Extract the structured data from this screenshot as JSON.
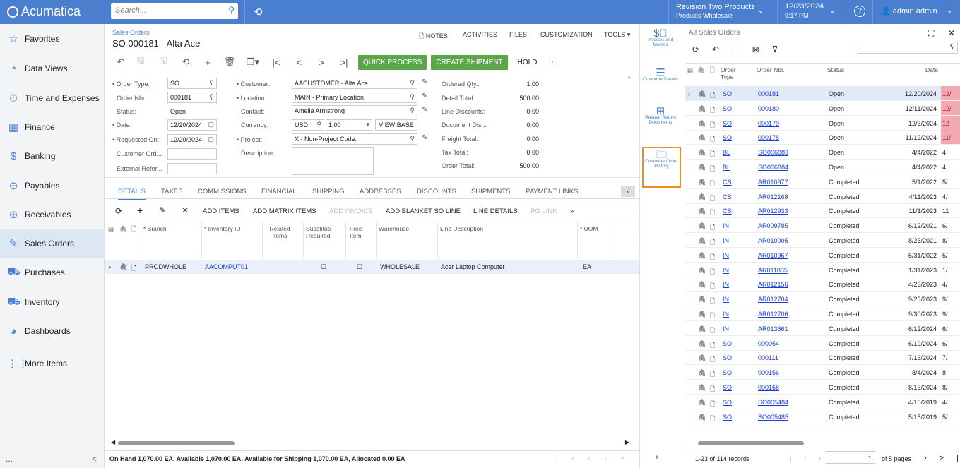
{
  "app": {
    "logo": "Acumatica",
    "search_placeholder": "Search...",
    "company": "Revision Two Products",
    "branch": "Products Wholesale",
    "date": "12/23/2024",
    "time": "9:17 PM",
    "user": "admin admin"
  },
  "sidebar": {
    "items": [
      {
        "label": "Favorites",
        "icon": "star-icon"
      },
      {
        "label": "Data Views",
        "icon": "pie-icon"
      },
      {
        "label": "Time and Expenses",
        "icon": "clock-icon"
      },
      {
        "label": "Finance",
        "icon": "calculator-icon"
      },
      {
        "label": "Banking",
        "icon": "dollar-icon"
      },
      {
        "label": "Payables",
        "icon": "minus-circle-icon"
      },
      {
        "label": "Receivables",
        "icon": "plus-circle-icon"
      },
      {
        "label": "Sales Orders",
        "icon": "edit-icon"
      },
      {
        "label": "Purchases",
        "icon": "cart-icon"
      },
      {
        "label": "Inventory",
        "icon": "truck-icon"
      },
      {
        "label": "Dashboards",
        "icon": "gauge-icon"
      },
      {
        "label": "More Items",
        "icon": "grid-icon"
      }
    ],
    "bottom": "...",
    "collapse": "<"
  },
  "page": {
    "breadcrumb": "Sales Orders",
    "title": "SO 000181 - Alta Ace",
    "links": [
      "NOTES",
      "ACTIVITIES",
      "FILES",
      "CUSTOMIZATION",
      "TOOLS"
    ],
    "quick_process": "QUICK PROCESS",
    "create_shipment": "CREATE SHIPMENT",
    "hold": "HOLD",
    "more": "···"
  },
  "form": {
    "order_type": {
      "label": "• Order Type:",
      "value": "SO"
    },
    "order_nbr": {
      "label": "Order Nbr.:",
      "value": "000181"
    },
    "status": {
      "label": "Status:",
      "value": "Open"
    },
    "date": {
      "label": "• Date:",
      "value": "12/20/2024"
    },
    "requested_on": {
      "label": "• Requested On:",
      "value": "12/20/2024"
    },
    "customer_ord": {
      "label": "Customer Ord...",
      "value": ""
    },
    "external_ref": {
      "label": "External Refer...",
      "value": ""
    },
    "customer": {
      "label": "• Customer:",
      "value": "AACUSTOMER - Alta Ace"
    },
    "location": {
      "label": "• Location:",
      "value": "MAIN - Primary Location"
    },
    "contact": {
      "label": "Contact:",
      "value": "Amelia Armstrong"
    },
    "currency": {
      "label": "Currency:",
      "value": "USD",
      "rate": "1.00",
      "view_base": "VIEW BASE"
    },
    "project": {
      "label": "• Project:",
      "value": "X - Non-Project Code."
    },
    "description": {
      "label": "Description:",
      "value": ""
    },
    "totals": [
      {
        "label": "Ordered Qty.:",
        "value": "1.00"
      },
      {
        "label": "Detail Total:",
        "value": "500.00"
      },
      {
        "label": "Line Discounts:",
        "value": "0.00"
      },
      {
        "label": "Document Dis...",
        "value": "0.00"
      },
      {
        "label": "Freight Total:",
        "value": "0.00"
      },
      {
        "label": "Tax Total:",
        "value": "0.00"
      },
      {
        "label": "Order Total:",
        "value": "500.00"
      }
    ]
  },
  "tabs": [
    "DETAILS",
    "TAXES",
    "COMMISSIONS",
    "FINANCIAL",
    "SHIPPING",
    "ADDRESSES",
    "DISCOUNTS",
    "SHIPMENTS",
    "PAYMENT LINKS"
  ],
  "grid_toolbar": [
    "ADD ITEMS",
    "ADD MATRIX ITEMS",
    "ADD INVOICE",
    "ADD BLANKET SO LINE",
    "LINE DETAILS",
    "PO LINK"
  ],
  "grid": {
    "headers": [
      "* Branch",
      "* Inventory ID",
      "Related Items",
      "Substituti Required",
      "Free Item",
      "Warehouse",
      "Line Description",
      "* UOM"
    ],
    "row": {
      "branch": "PRODWHOLE",
      "inventory": "AACOMPUT01",
      "warehouse": "WHOLESALE",
      "description": "Acer Laptop Computer",
      "uom": "EA"
    }
  },
  "footer": "On Hand 1,070.00 EA, Available 1,070.00 EA, Available for Shipping 1,070.00 EA, Allocated 0.00 EA",
  "right_panel": [
    {
      "label": "Invoices and Memos",
      "icon": "invoice-icon"
    },
    {
      "label": "Customer Details",
      "icon": "list-icon"
    },
    {
      "label": "Related Return Documents",
      "icon": "tree-icon"
    },
    {
      "label": "Customer Order History",
      "icon": "folder-icon"
    }
  ],
  "list": {
    "title": "All Sales Orders",
    "headers": [
      "Order Type",
      "Order Nbr.",
      "Status",
      "Date"
    ],
    "rows": [
      [
        "SO",
        "000181",
        "Open",
        "12/20/2024"
      ],
      [
        "SO",
        "000180",
        "Open",
        "12/11/2024"
      ],
      [
        "SO",
        "000179",
        "Open",
        "12/3/2024"
      ],
      [
        "SO",
        "000178",
        "Open",
        "11/12/2024"
      ],
      [
        "BL",
        "SO006883",
        "Open",
        "4/4/2022"
      ],
      [
        "BL",
        "SO006884",
        "Open",
        "4/4/2022"
      ],
      [
        "CS",
        "AR010977",
        "Completed",
        "5/1/2022"
      ],
      [
        "CS",
        "AR012168",
        "Completed",
        "4/11/2023"
      ],
      [
        "CS",
        "AR012933",
        "Completed",
        "11/1/2023"
      ],
      [
        "IN",
        "AR009785",
        "Completed",
        "6/12/2021"
      ],
      [
        "IN",
        "AR010005",
        "Completed",
        "8/23/2021"
      ],
      [
        "IN",
        "AR010967",
        "Completed",
        "5/31/2022"
      ],
      [
        "IN",
        "AR011835",
        "Completed",
        "1/31/2023"
      ],
      [
        "IN",
        "AR012156",
        "Completed",
        "4/23/2023"
      ],
      [
        "IN",
        "AR012704",
        "Completed",
        "9/23/2023"
      ],
      [
        "IN",
        "AR012706",
        "Completed",
        "9/30/2023"
      ],
      [
        "IN",
        "AR013661",
        "Completed",
        "6/12/2024"
      ],
      [
        "SO",
        "000054",
        "Completed",
        "6/19/2024"
      ],
      [
        "SO",
        "000111",
        "Completed",
        "7/16/2024"
      ],
      [
        "SO",
        "000156",
        "Completed",
        "8/4/2024"
      ],
      [
        "SO",
        "000168",
        "Completed",
        "8/13/2024"
      ],
      [
        "SO",
        "SO005484",
        "Completed",
        "4/10/2019"
      ],
      [
        "SO",
        "SO005485",
        "Completed",
        "5/15/2019"
      ]
    ],
    "extra": [
      "12/",
      "12/",
      "12",
      "11/",
      "4",
      "4",
      "5/",
      "4/",
      "11",
      "6/",
      "8/",
      "5/",
      "1/",
      "4/",
      "9/",
      "9/",
      "6/",
      "6/",
      "7/",
      "8",
      "8/",
      "4/",
      "5/"
    ],
    "records": "1-23 of 114 records",
    "page": "1",
    "pages": "of 5 pages"
  }
}
